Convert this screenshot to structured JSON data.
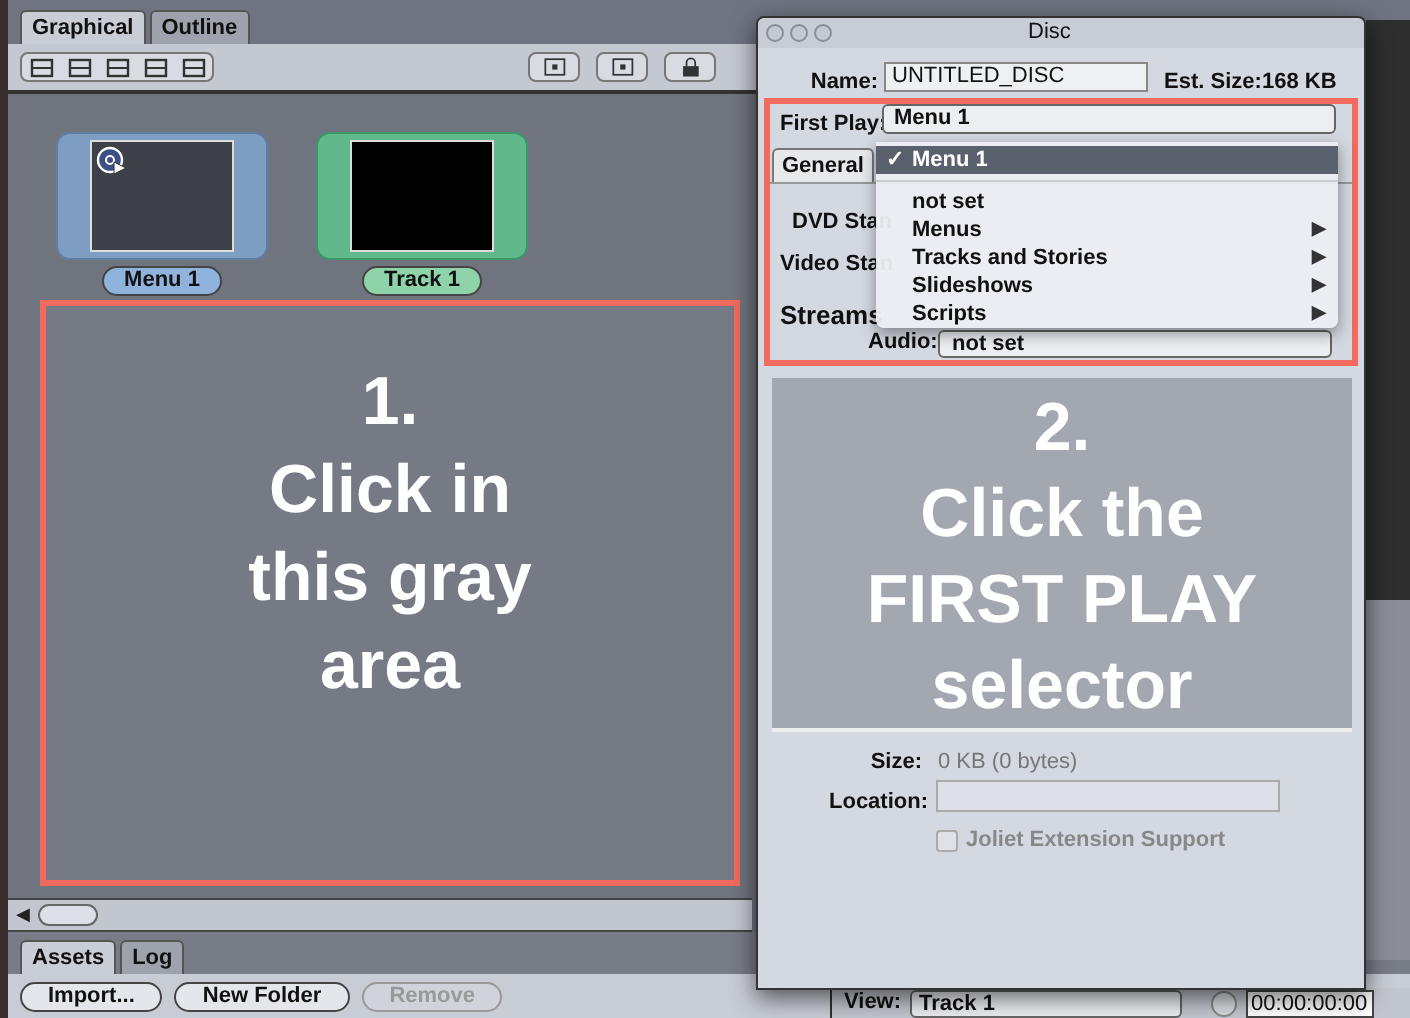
{
  "main_window": {
    "tabs": [
      {
        "label": "Graphical",
        "selected": true
      },
      {
        "label": "Outline",
        "selected": false
      }
    ],
    "tiles": [
      {
        "label": "Menu 1",
        "kind": "menu"
      },
      {
        "label": "Track 1",
        "kind": "track"
      }
    ],
    "annotation": [
      "1.",
      "Click in",
      "this gray",
      "area"
    ],
    "bottom_tabs": [
      {
        "label": "Assets",
        "selected": true
      },
      {
        "label": "Log",
        "selected": false
      }
    ],
    "buttons": [
      {
        "label": "Import...",
        "disabled": false
      },
      {
        "label": "New Folder",
        "disabled": false
      },
      {
        "label": "Remove",
        "disabled": true
      }
    ],
    "scroll_left_arrow": "◀"
  },
  "disc_window": {
    "title": "Disc",
    "name_label": "Name:",
    "name_value": "UNTITLED_DISC",
    "est_size_label": "Est. Size:",
    "est_size": "168 KB",
    "first_play_label": "First Play:",
    "first_play_value": "Menu 1",
    "tabs": [
      {
        "label": "General",
        "selected": true
      }
    ],
    "dvd_standard_label": "DVD Stan",
    "video_standard_label": "Video Stan",
    "streams_label": "Streams",
    "audio_label": "Audio:",
    "audio_value": "not set",
    "menu": [
      {
        "label": "Menu 1",
        "checked": true,
        "selected": true,
        "submenu": false
      },
      {
        "label": "not set",
        "checked": false,
        "selected": false,
        "submenu": false
      },
      {
        "label": "Menus",
        "checked": false,
        "selected": false,
        "submenu": true
      },
      {
        "label": "Tracks and Stories",
        "checked": false,
        "selected": false,
        "submenu": true
      },
      {
        "label": "Slideshows",
        "checked": false,
        "selected": false,
        "submenu": true
      },
      {
        "label": "Scripts",
        "checked": false,
        "selected": false,
        "submenu": true
      }
    ],
    "checkmark": "✓",
    "submenu_arrow": "▶",
    "annotation": [
      "2.",
      "Click the",
      "FIRST PLAY",
      "selector"
    ],
    "size_label": "Size:",
    "size_value": "0 KB (0 bytes)",
    "location_label": "Location:",
    "joliet": {
      "label": "Joliet Extension Support",
      "checked": false,
      "disabled": true
    }
  },
  "viewer": {
    "view_label": "View:",
    "view_value": "Track 1",
    "timecode": "00:00:00:00"
  }
}
